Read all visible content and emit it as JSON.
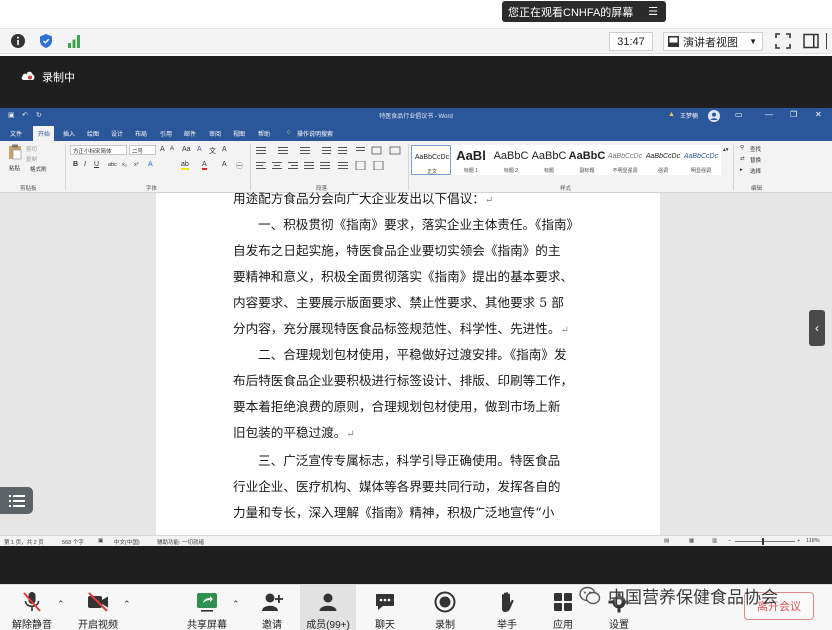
{
  "share_banner": {
    "text": "您正在观看CNHFA的屏幕"
  },
  "meeting_toolbar": {
    "timer": "31:47",
    "view_mode": "演讲者视图"
  },
  "recording": {
    "label": "录制中"
  },
  "word": {
    "title": "特医食品行业倡议书 - Word",
    "user": "王梦楠",
    "tabs": [
      "文件",
      "开始",
      "插入",
      "绘图",
      "设计",
      "布局",
      "引用",
      "邮件",
      "审阅",
      "视图",
      "帮助",
      "操作说明搜索"
    ],
    "ribbon": {
      "paste_label": "粘贴",
      "cut_label": "剪切",
      "copy_label": "复制",
      "format_painter_label": "格式刷",
      "clipboard_group": "剪贴板",
      "font_name": "方正小标宋简体",
      "font_size": "二号",
      "font_group": "字体",
      "paragraph_group": "段落",
      "styles": [
        {
          "sample": "AaBbCcDc",
          "name": "正文"
        },
        {
          "sample": "AaBl",
          "name": "标题 1"
        },
        {
          "sample": "AaBbC",
          "name": "标题 2"
        },
        {
          "sample": "AaBbC",
          "name": "标题"
        },
        {
          "sample": "AaBbC",
          "name": "副标题"
        },
        {
          "sample": "AaBbCcDc",
          "name": "不明显强调"
        },
        {
          "sample": "AaBbCcDc",
          "name": "强调"
        },
        {
          "sample": "AaBbCcDc",
          "name": "明显强调"
        }
      ],
      "styles_group": "样式",
      "find_label": "查找",
      "replace_label": "替换",
      "select_label": "选择",
      "editing_group": "编辑"
    },
    "document_lines": [
      "用途配方食品分会向广大企业发出以下倡议：",
      "一、积极贯彻《指南》要求，落实企业主体责任。《指南》",
      "自发布之日起实施，特医食品企业要切实领会《指南》的主",
      "要精神和意义，积极全面贯彻落实《指南》提出的基本要求、",
      "内容要求、主要展示版面要求、禁止性要求、其他要求 5 部",
      "分内容，充分展现特医食品标签规范性、科学性、先进性。",
      "二、合理规划包材使用，平稳做好过渡安排。《指南》发",
      "布后特医食品企业要积极进行标签设计、排版、印刷等工作，",
      "要本着拒绝浪费的原则，合理规划包材使用，做到市场上新",
      "旧包装的平稳过渡。",
      "三、广泛宣传专属标志，科学引导正确使用。特医食品",
      "行业企业、医疗机构、媒体等各界要共同行动，发挥各自的",
      "力量和专长，深入理解《指南》精神，积极广泛地宣传“小"
    ],
    "status": {
      "page": "第 1 页，共 2 页",
      "words": "568 个字",
      "language": "中文(中国)",
      "accessibility": "辅助功能: 一切就绪",
      "zoom": "118%"
    }
  },
  "bottom_bar": {
    "mute": "解除静音",
    "video": "开启视频",
    "share": "共享屏幕",
    "invite": "邀请",
    "members": "成员(99+)",
    "chat": "聊天",
    "record": "录制",
    "raise_hand": "举手",
    "apps": "应用",
    "settings": "设置",
    "leave": "离开会议"
  },
  "watermark": {
    "org": "中国营养保健食品协会"
  },
  "colors": {
    "word_blue": "#2b579a",
    "leave_red": "#e05050",
    "record_red": "#e23b3b"
  }
}
